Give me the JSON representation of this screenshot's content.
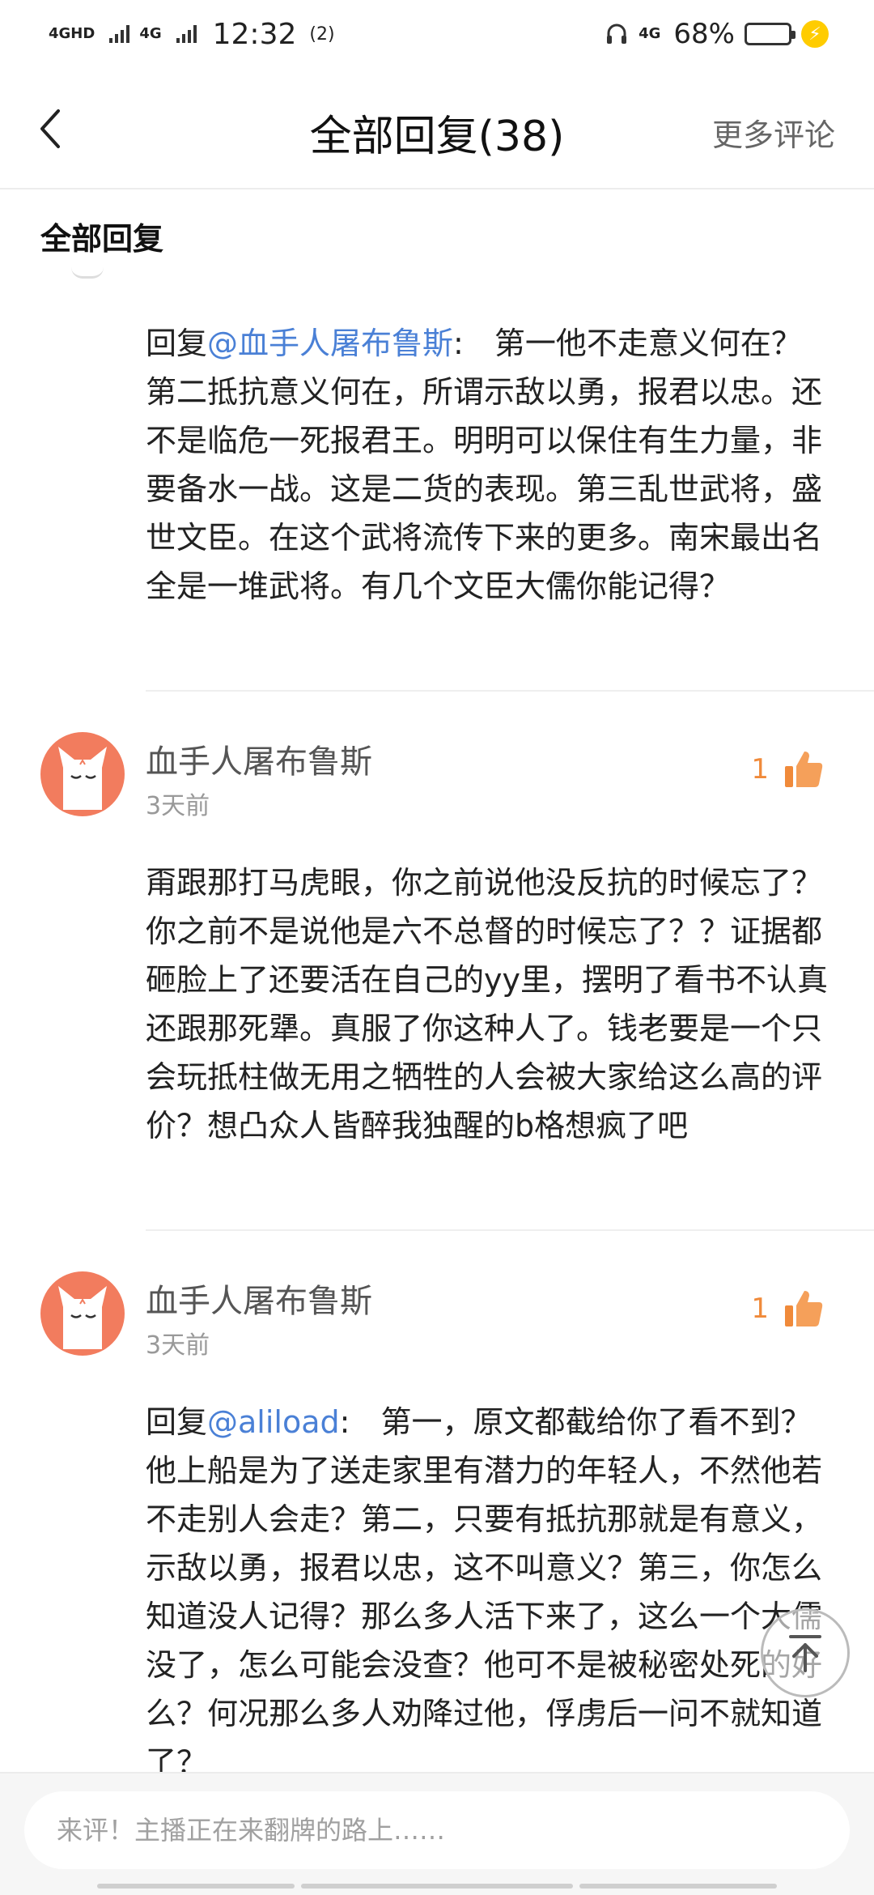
{
  "status_bar": {
    "network1": "4GHD",
    "network2": "4G",
    "time": "12:32",
    "hotspot": "(2)",
    "network_right": "4G",
    "battery": "68%",
    "battery_level": 0.68,
    "battery_color": "#28c840"
  },
  "nav": {
    "title": "全部回复(38)",
    "more": "更多评论"
  },
  "section": {
    "title": "全部回复"
  },
  "replies": [
    {
      "prefix": "回复",
      "mention": "@血手人屠布鲁斯",
      "text": ":　第一他不走意义何在？第二抵抗意义何在，所谓示敌以勇，报君以忠。还不是临危一死报君王。明明可以保住有生力量，非要备水一战。这是二货的表现。第三乱世武将，盛世文臣。在这个武将流传下来的更多。南宋最出名全是一堆武将。有几个文臣大儒你能记得？"
    },
    {
      "username": "血手人屠布鲁斯",
      "time": "3天前",
      "likes": "1",
      "text": "甭跟那打马虎眼，你之前说他没反抗的时候忘了？你之前不是说他是六不总督的时候忘了？？证据都砸脸上了还要活在自己的yy里，摆明了看书不认真还跟那死犟。真服了你这种人了。钱老要是一个只会玩抵柱做无用之牺牲的人会被大家给这么高的评价？想凸众人皆醉我独醒的b格想疯了吧"
    },
    {
      "username": "血手人屠布鲁斯",
      "time": "3天前",
      "likes": "1",
      "prefix": "回复",
      "mention": "@aliload",
      "text": ":　第一，原文都截给你了看不到？他上船是为了送走家里有潜力的年轻人，不然他若不走别人会走？第二，只要有抵抗那就是有意义，示敌以勇，报君以忠，这不叫意义？第三，你怎么知道没人记得？那么多人活下来了，这么一个大儒没了，怎么可能会没查？他可不是被秘密处死的好么？何况那么多人劝降过他，俘虏后一问不就知道了？"
    }
  ],
  "bottom": {
    "placeholder": "来评！主播正在来翻牌的路上……"
  },
  "colors": {
    "accent_link": "#4a80d6",
    "like": "#f08a3a",
    "avatar_bg": "#f27c5e"
  }
}
